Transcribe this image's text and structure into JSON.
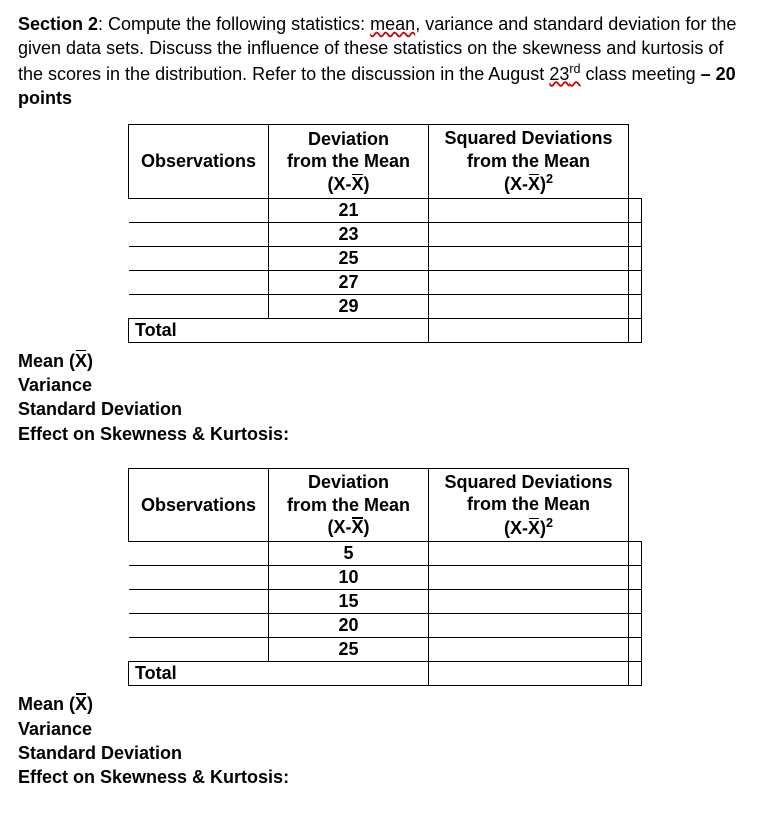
{
  "intro": {
    "section_label": "Section 2",
    "text_before_mean": ": Compute the following statistics: ",
    "mean_word": "mean",
    "text_mid": ", variance and standard deviation for the given data sets. Discuss the influence of these statistics on the skewness and kurtosis of the scores in the distribution. Refer to the discussion in the August ",
    "date_num": "23",
    "date_suffix": "rd",
    "text_after_date": " class meeting ",
    "dash": "–",
    "points": " 20 points"
  },
  "table_headers": {
    "observations": "Observations",
    "deviation_line1": "Deviation",
    "deviation_line2": "from the Mean",
    "dev_formula_prefix": "(X-",
    "dev_formula_x": "X",
    "dev_formula_suffix": ")",
    "squared_line1": "Squared Deviations",
    "squared_line2": "from the Mean",
    "sq_formula_prefix": "(X-",
    "sq_formula_x": "X",
    "sq_formula_suffix": ")",
    "sq_exp": "2",
    "total": "Total"
  },
  "table1": {
    "rows": [
      "21",
      "23",
      "25",
      "27",
      "29"
    ]
  },
  "table2": {
    "rows": [
      "5",
      "10",
      "15",
      "20",
      "25"
    ]
  },
  "stats": {
    "mean_prefix": "Mean (",
    "mean_x": "X",
    "mean_suffix": ")",
    "variance": "Variance",
    "sd": "Standard Deviation",
    "effect": "Effect on Skewness & Kurtosis:"
  }
}
